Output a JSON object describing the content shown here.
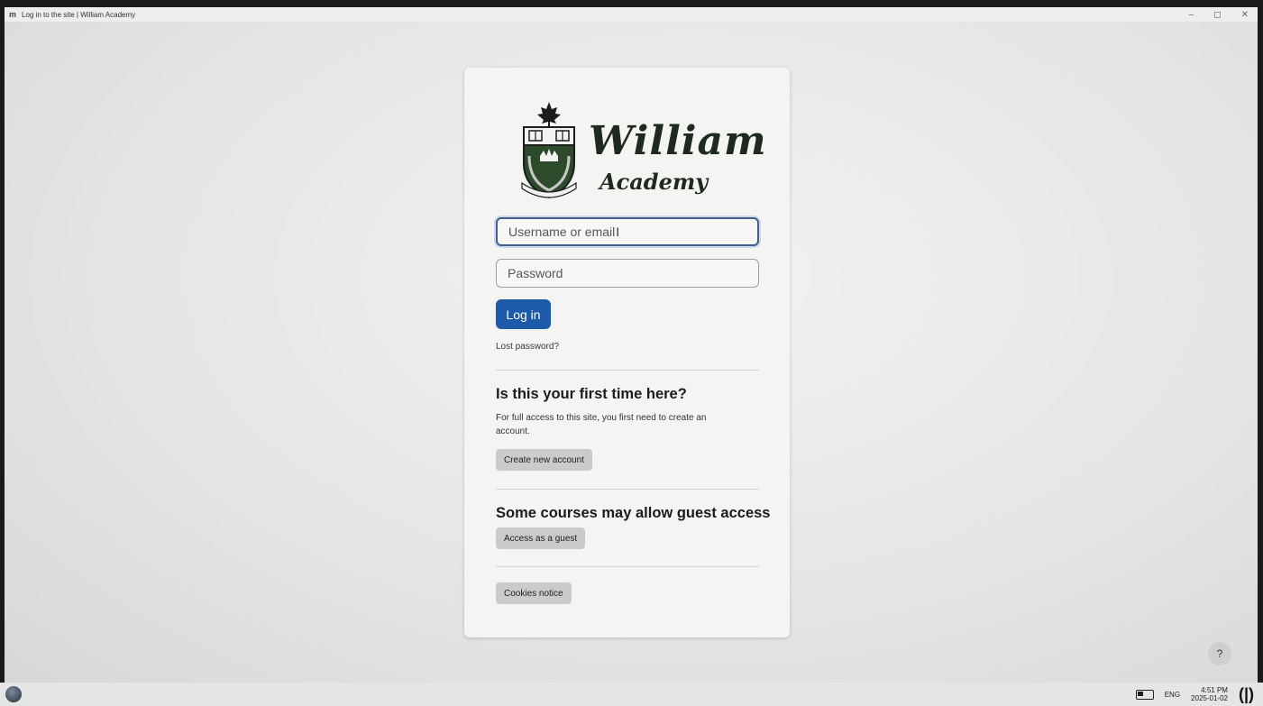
{
  "window": {
    "title": "Log in to the site | William Academy",
    "app_icon": "moodle-icon",
    "controls": [
      "–",
      "◻",
      "✕"
    ]
  },
  "logo": {
    "name_main": "William",
    "name_sub": "Academy",
    "icon": "crest-icon"
  },
  "login": {
    "username_placeholder": "Username or email",
    "password_placeholder": "Password",
    "login_button": "Log in",
    "lost_password": "Lost password?"
  },
  "signup": {
    "heading": "Is this your first time here?",
    "text": "For full access to this site, you first need to create an account.",
    "button": "Create new account"
  },
  "guest": {
    "heading": "Some courses may allow guest access",
    "button": "Access as a guest"
  },
  "cookies": {
    "button": "Cookies notice"
  },
  "help": {
    "label": "?"
  },
  "taskbar": {
    "language": "ENG",
    "time": "4:51 PM",
    "date": "2025-01-02"
  }
}
